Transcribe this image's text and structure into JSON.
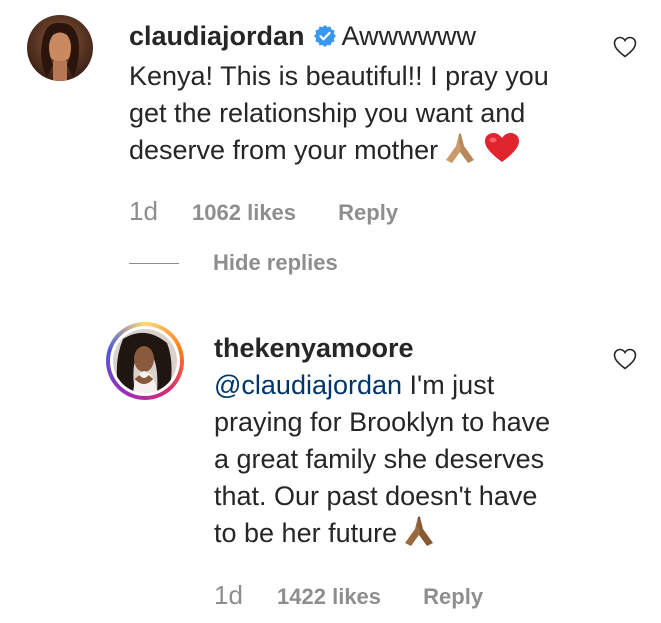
{
  "comments": [
    {
      "username": "claudiajordan",
      "verified": true,
      "text_lines": [
        "Awwwwww",
        "Kenya! This is beautiful!! I pray you",
        "get the relationship you want and",
        "deserve from your mother"
      ],
      "emojis": [
        "folded-hands",
        "red-heart"
      ],
      "time": "1d",
      "likes": "1062 likes",
      "reply": "Reply"
    },
    {
      "username": "thekenyamoore",
      "mention": "@claudiajordan",
      "text_lines": [
        " I'm just",
        "praying for Brooklyn to have",
        "a great family she deserves",
        "that. Our past doesn't have",
        "to be her future"
      ],
      "emojis": [
        "folded-hands"
      ],
      "time": "1d",
      "likes": "1422 likes",
      "reply": "Reply"
    }
  ],
  "thread": {
    "hide_replies": "Hide replies"
  },
  "icons": {
    "like": "heart-outline-icon",
    "verified": "verified-badge-icon"
  },
  "colors": {
    "verified": "#3897f0",
    "mention": "#003569",
    "muted": "#8e8e8e",
    "heart": "#ed4956"
  }
}
